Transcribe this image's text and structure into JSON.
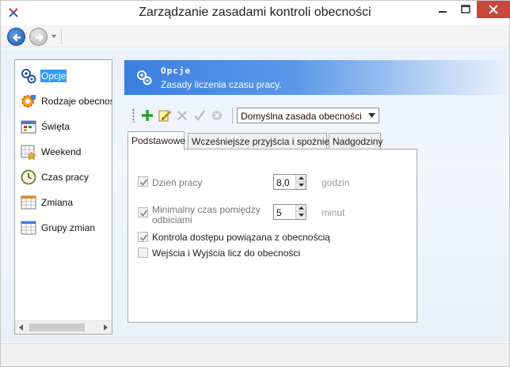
{
  "window": {
    "title": "Zarządzanie zasadami kontroli obecności",
    "accent_close": "#c7483a"
  },
  "sidebar": {
    "items": [
      {
        "label": "Opcje",
        "icon": "gears-icon",
        "selected": true
      },
      {
        "label": "Rodzaje obecności",
        "icon": "gear-orange-icon",
        "selected": false
      },
      {
        "label": "Święta",
        "icon": "holiday-calendar-icon",
        "selected": false
      },
      {
        "label": "Weekend",
        "icon": "weekend-calendar-star-icon",
        "selected": false
      },
      {
        "label": "Czas pracy",
        "icon": "clock-icon",
        "selected": false
      },
      {
        "label": "Zmiana",
        "icon": "grid-calendar-icon",
        "selected": false
      },
      {
        "label": "Grupy zmian",
        "icon": "grid-calendar-group-icon",
        "selected": false
      }
    ]
  },
  "header": {
    "title": "Opcje",
    "subtitle": "Zasady liczenia czasu pracy."
  },
  "toolbar": {
    "buttons": [
      "add-icon",
      "edit-icon",
      "delete-icon",
      "confirm-icon",
      "cancel-icon"
    ],
    "policy_select": "Domyślna zasada obecności"
  },
  "tabs": [
    {
      "label": "Podstawowe",
      "active": true
    },
    {
      "label": "Wcześniejsze przyjścia i spoźnienia",
      "active": false
    },
    {
      "label": "Nadgodziny",
      "active": false
    }
  ],
  "form": {
    "workday_label": "Dzień pracy",
    "workday_value": "8,0",
    "workday_unit": "godzin",
    "min_time_label_line1": "Minimalny czas pomiędzy",
    "min_time_label_line2": "odbiciami",
    "min_time_value": "5",
    "min_time_unit": "minut",
    "access_control_label": "Kontrola dostępu powiązana z obecnością",
    "entries_label": "Wejścia i Wyjścia licz do obecności"
  }
}
